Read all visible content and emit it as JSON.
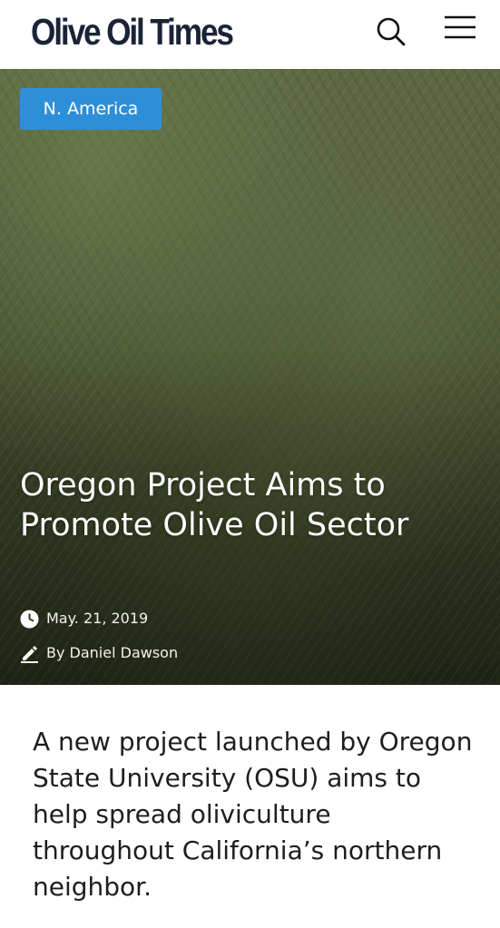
{
  "header": {
    "logo_text": "Olive Oil Times",
    "search_icon": "search-icon",
    "menu_icon": "hamburger-menu-icon"
  },
  "article": {
    "category": "N. America",
    "title": "Oregon Project Aims to Promote Olive Oil Sector",
    "date": "May. 21, 2019",
    "date_icon": "clock-icon",
    "author": "By Daniel Dawson",
    "author_icon": "pencil-icon",
    "lede": "A new project launched by Oregon State University (OSU) aims to help spread oliviculture throughout California’s northern neighbor."
  },
  "colors": {
    "badge": "#2e8fd9",
    "logo": "#1b2436",
    "text": "#1e1e1e"
  }
}
